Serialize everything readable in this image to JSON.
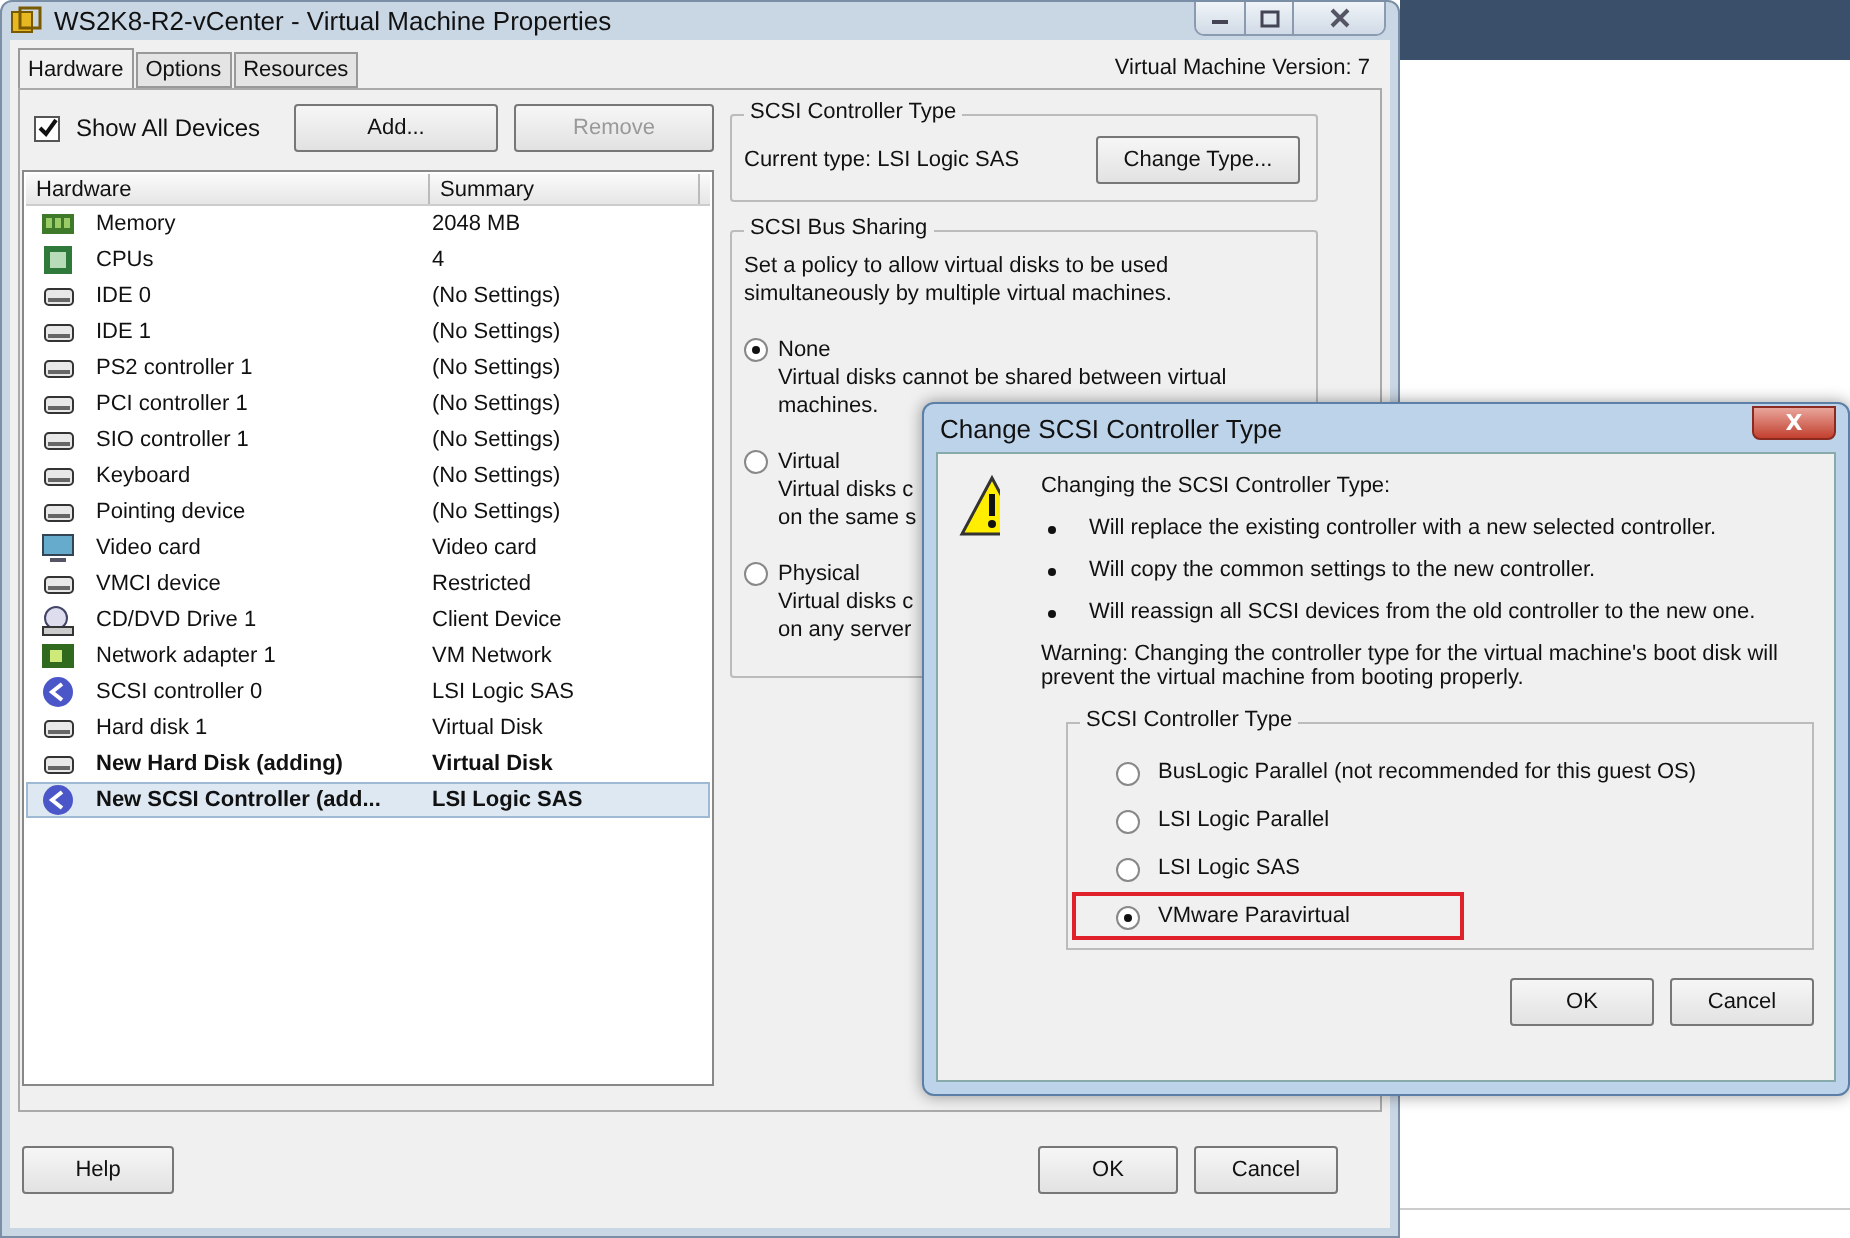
{
  "window": {
    "title": "WS2K8-R2-vCenter - Virtual Machine Properties",
    "version": "Virtual Machine Version: 7"
  },
  "tabs": [
    {
      "label": "Hardware",
      "selected": true
    },
    {
      "label": "Options",
      "selected": false
    },
    {
      "label": "Resources",
      "selected": false
    }
  ],
  "show_all_devices": {
    "label": "Show All Devices",
    "checked": true
  },
  "toolbar": [
    {
      "label": "Add...",
      "disabled": false
    },
    {
      "label": "Remove",
      "disabled": true
    }
  ],
  "table": {
    "columns": [
      "Hardware",
      "Summary"
    ],
    "rows": [
      {
        "kind": "memory",
        "name": "Memory",
        "summary": "2048 MB",
        "pending": false,
        "selected": false
      },
      {
        "kind": "cpu",
        "name": "CPUs",
        "summary": "4",
        "pending": false,
        "selected": false
      },
      {
        "kind": "device",
        "name": "IDE 0",
        "summary": "(No Settings)",
        "pending": false,
        "selected": false
      },
      {
        "kind": "device",
        "name": "IDE 1",
        "summary": "(No Settings)",
        "pending": false,
        "selected": false
      },
      {
        "kind": "device",
        "name": "PS2 controller 1",
        "summary": "(No Settings)",
        "pending": false,
        "selected": false
      },
      {
        "kind": "device",
        "name": "PCI controller 1",
        "summary": "(No Settings)",
        "pending": false,
        "selected": false
      },
      {
        "kind": "device",
        "name": "SIO controller 1",
        "summary": "(No Settings)",
        "pending": false,
        "selected": false
      },
      {
        "kind": "device",
        "name": "Keyboard",
        "summary": "(No Settings)",
        "pending": false,
        "selected": false
      },
      {
        "kind": "device",
        "name": "Pointing device",
        "summary": "(No Settings)",
        "pending": false,
        "selected": false
      },
      {
        "kind": "display",
        "name": "Video card",
        "summary": "Video card",
        "pending": false,
        "selected": false
      },
      {
        "kind": "device",
        "name": "VMCI device",
        "summary": "Restricted",
        "pending": false,
        "selected": false
      },
      {
        "kind": "cdrom",
        "name": "CD/DVD Drive 1",
        "summary": "Client Device",
        "pending": false,
        "selected": false
      },
      {
        "kind": "network",
        "name": "Network adapter 1",
        "summary": "VM Network",
        "pending": false,
        "selected": false
      },
      {
        "kind": "scsi",
        "name": "SCSI controller 0",
        "summary": "LSI Logic SAS",
        "pending": false,
        "selected": false
      },
      {
        "kind": "device",
        "name": "Hard disk 1",
        "summary": "Virtual Disk",
        "pending": false,
        "selected": false
      },
      {
        "kind": "device",
        "name": "New Hard Disk (adding)",
        "summary": "Virtual Disk",
        "pending": true,
        "selected": false
      },
      {
        "kind": "scsi",
        "name": "New SCSI Controller (add...",
        "summary": "LSI Logic SAS",
        "pending": true,
        "selected": true
      }
    ]
  },
  "controller_type": {
    "title": "SCSI Controller Type",
    "current": "Current type:  LSI Logic SAS",
    "button": "Change Type..."
  },
  "bus_sharing": {
    "title": "SCSI Bus Sharing",
    "description": "Set a policy to allow virtual disks to be used simultaneously by multiple virtual machines.",
    "options": [
      {
        "label": "None",
        "lines": [
          "Virtual disks cannot be shared between virtual",
          "machines."
        ],
        "selected": true
      },
      {
        "label": "Virtual",
        "lines": [
          "Virtual disks c",
          "on the same s"
        ],
        "selected": false
      },
      {
        "label": "Physical",
        "lines": [
          "Virtual disks c",
          "on any server"
        ],
        "selected": false
      }
    ]
  },
  "footer": {
    "help": "Help",
    "ok": "OK",
    "cancel": "Cancel"
  },
  "dialog": {
    "title": "Change SCSI Controller Type",
    "close": "X",
    "heading": "Changing the SCSI Controller Type:",
    "bullets": [
      "Will replace the existing controller with a new selected controller.",
      "Will copy the common settings to the new controller.",
      "Will reassign all SCSI devices from the old controller to the new one."
    ],
    "warning": "Warning: Changing the controller type for the virtual machine's boot disk will prevent the virtual machine from booting properly.",
    "group_title": "SCSI Controller Type",
    "options": [
      {
        "label": "BusLogic Parallel (not recommended for this guest OS)",
        "selected": false,
        "highlighted": false
      },
      {
        "label": "LSI Logic Parallel",
        "selected": false,
        "highlighted": false
      },
      {
        "label": "LSI Logic SAS",
        "selected": false,
        "highlighted": false
      },
      {
        "label": "VMware Paravirtual",
        "selected": true,
        "highlighted": true
      }
    ],
    "ok": "OK",
    "cancel": "Cancel"
  }
}
